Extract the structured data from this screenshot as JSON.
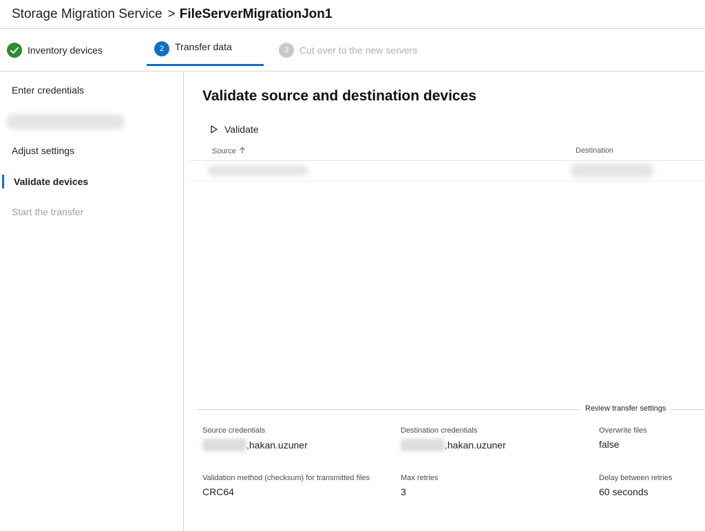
{
  "header": {
    "service": "Storage Migration Service",
    "separator": ">",
    "job_name": "FileServerMigrationJon1"
  },
  "stepper": {
    "steps": [
      {
        "number": "1",
        "label": "Inventory devices",
        "state": "completed"
      },
      {
        "number": "2",
        "label": "Transfer data",
        "state": "active"
      },
      {
        "number": "3",
        "label": "Cut over to the new servers",
        "state": "disabled"
      }
    ]
  },
  "sidebar": {
    "items": [
      {
        "label": "Enter credentials",
        "state": "normal"
      },
      {
        "label": "Adjust settings",
        "state": "normal"
      },
      {
        "label": "Validate devices",
        "state": "active"
      },
      {
        "label": "Start the transfer",
        "state": "disabled"
      }
    ]
  },
  "main": {
    "title": "Validate source and destination devices",
    "validate_label": "Validate",
    "table": {
      "columns": [
        "Source",
        "Destination"
      ]
    },
    "review_label": "Review transfer settings",
    "settings": [
      {
        "label": "Source credentials",
        "value": ",hakan.uzuner"
      },
      {
        "label": "Destination credentials",
        "value": ",hakan.uzuner"
      },
      {
        "label": "Overwrite files",
        "value": "false"
      },
      {
        "label": "Validation method (checksum) for transmitted files",
        "value": "CRC64"
      },
      {
        "label": "Max retries",
        "value": "3"
      },
      {
        "label": "Delay between retries",
        "value": "60 seconds"
      }
    ]
  },
  "colors": {
    "accent": "#0f6fc6",
    "success": "#2e8b2e",
    "disabled": "#c8c8c8"
  }
}
